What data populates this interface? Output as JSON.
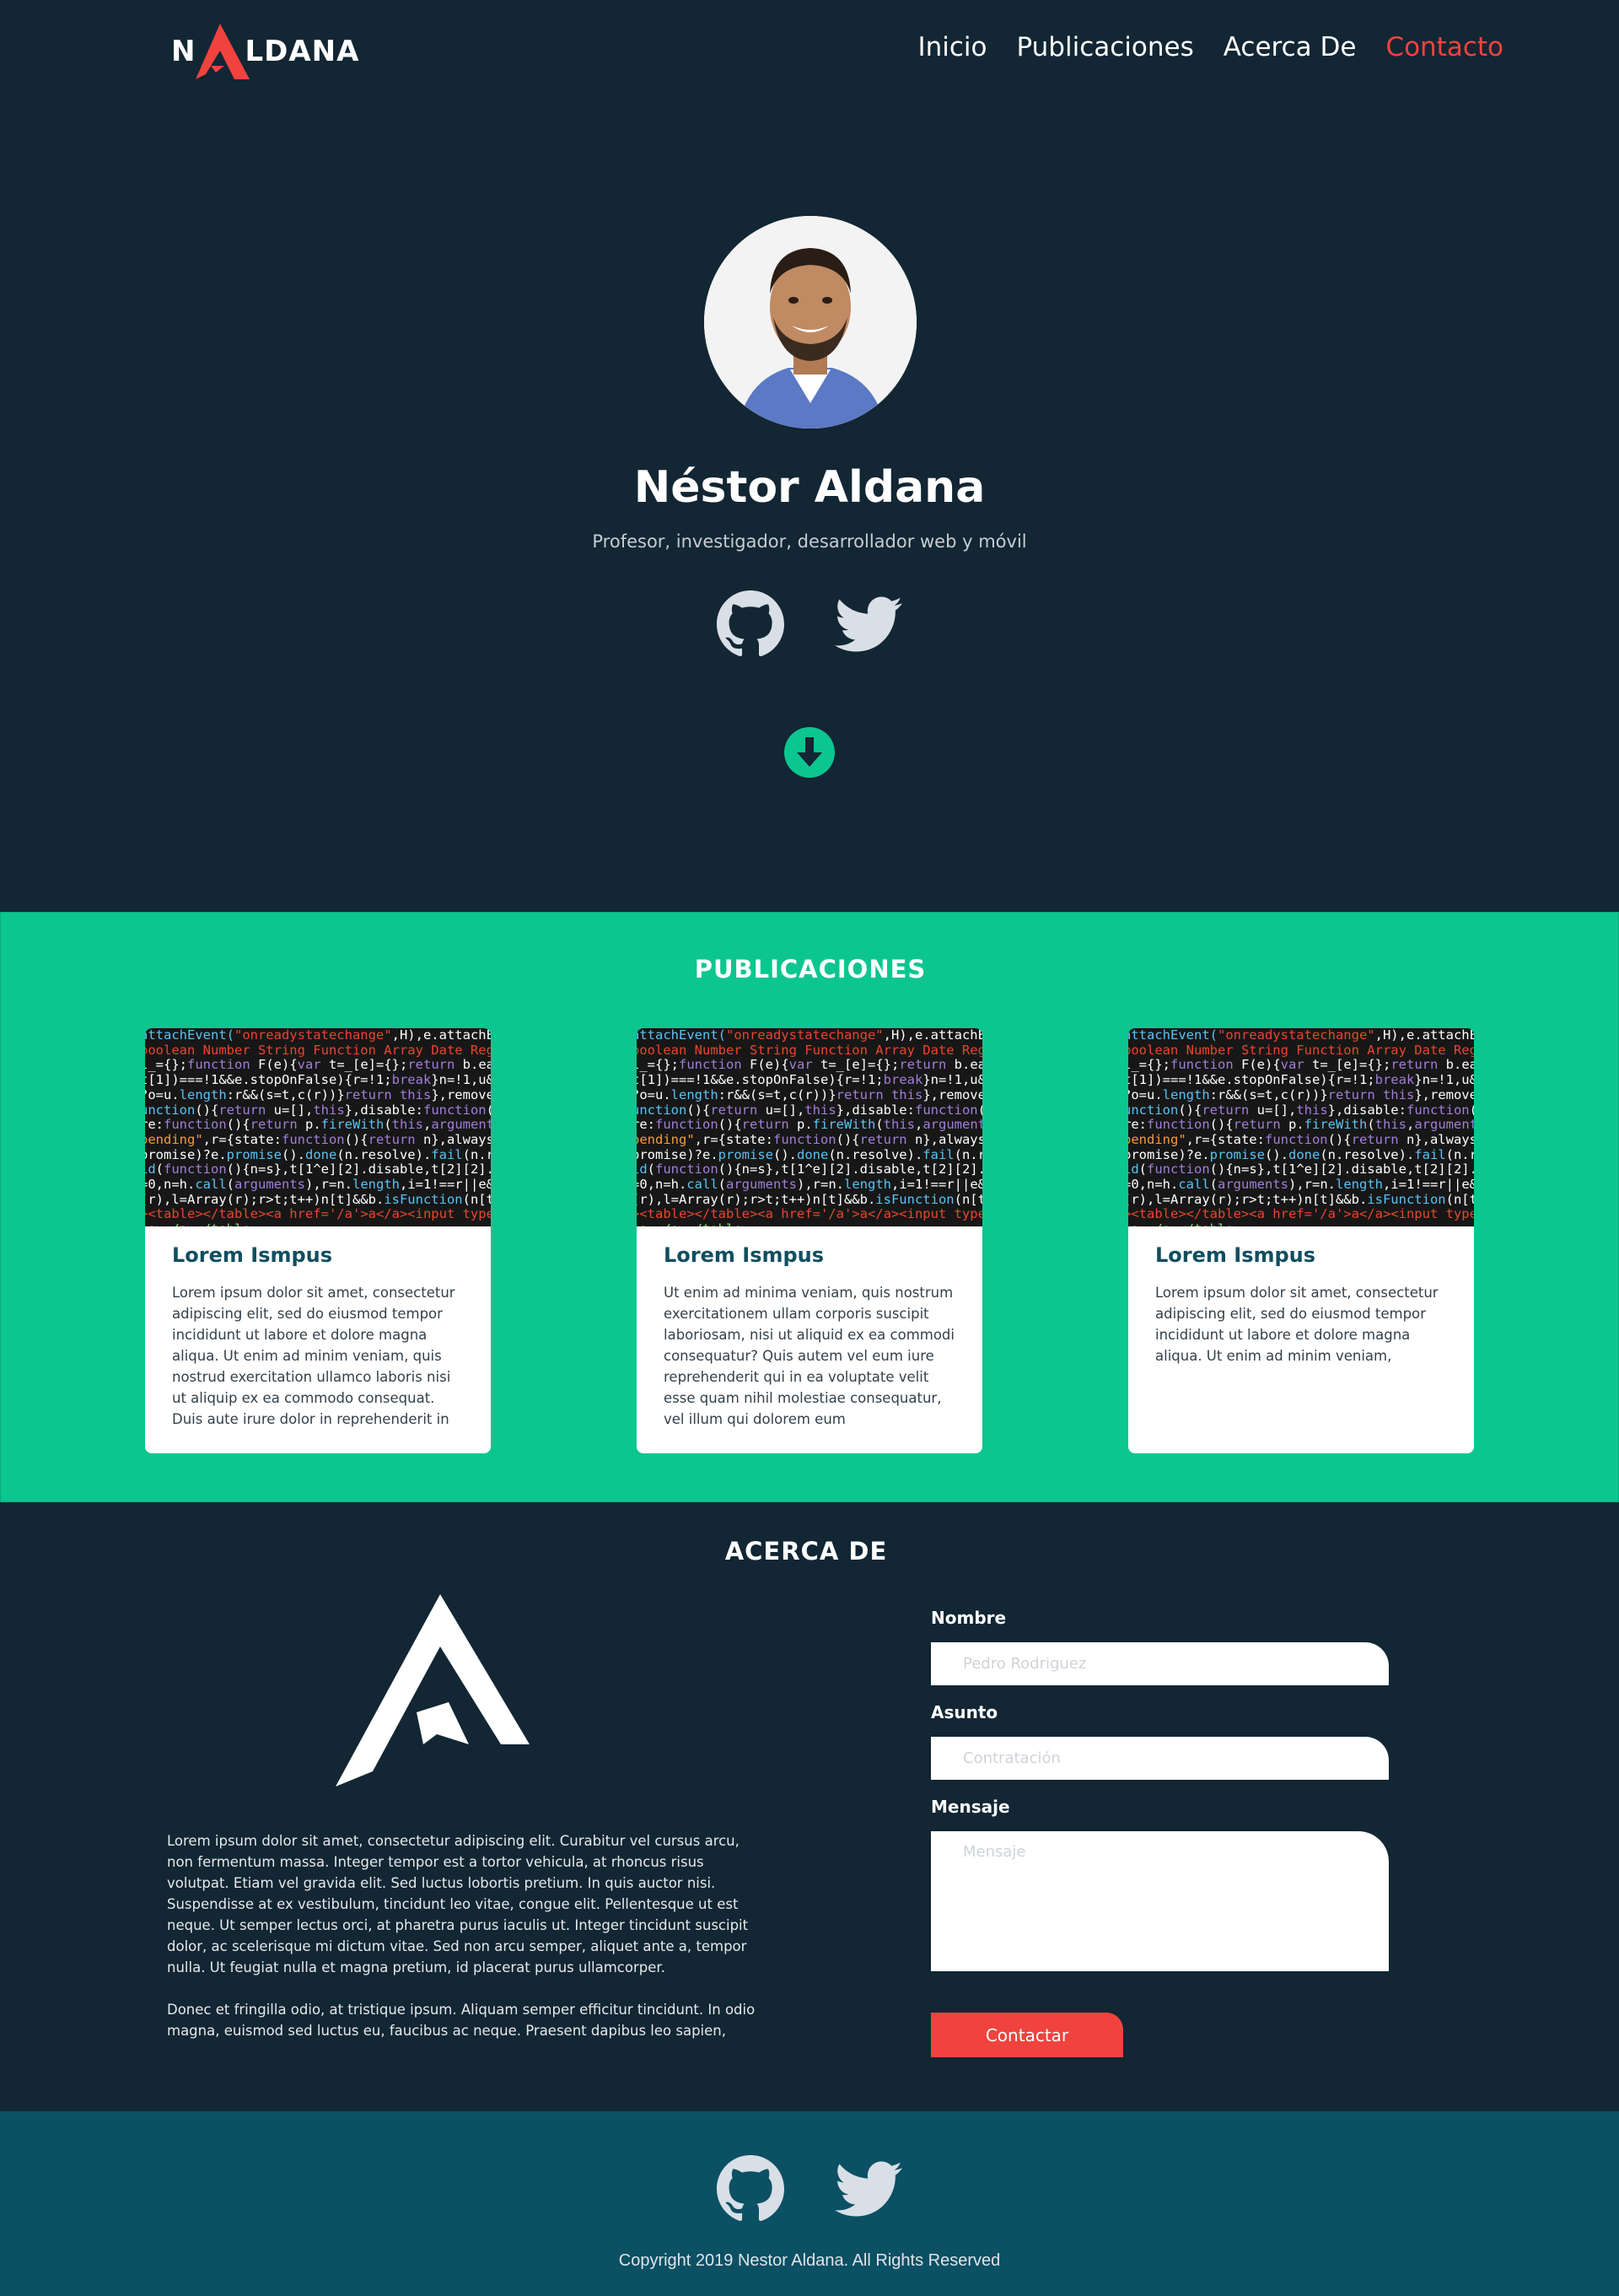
{
  "brand": {
    "logo_text_left": "N",
    "logo_text_right": "LDANA",
    "accent": "#f0433e"
  },
  "nav": {
    "items": [
      {
        "label": "Inicio"
      },
      {
        "label": "Publicaciones"
      },
      {
        "label": "Acerca De"
      },
      {
        "label": "Contacto",
        "active": true
      }
    ]
  },
  "hero": {
    "name": "Néstor Aldana",
    "subtitle": "Profesor, investigador, desarrollador web y móvil",
    "icons": [
      "github-icon",
      "twitter-icon",
      "arrow-down-circle-icon"
    ]
  },
  "publicaciones": {
    "title": "PUBLICACIONES",
    "background": "#0cc68f",
    "cards": [
      {
        "title": "Lorem Ismpus",
        "text": "Lorem ipsum dolor sit amet, consectetur adipiscing elit, sed do eiusmod tempor incididunt ut labore et dolore magna aliqua. Ut enim ad minim veniam, quis nostrud exercitation ullamco laboris nisi ut aliquip ex ea commodo consequat. Duis aute irure dolor in reprehenderit in"
      },
      {
        "title": "Lorem Ismpus",
        "text": "Ut enim ad minima veniam, quis nostrum exercitationem ullam corporis suscipit laboriosam, nisi ut aliquid ex ea commodi consequatur? Quis autem vel eum iure reprehenderit qui in ea voluptate velit esse quam nihil molestiae consequatur, vel illum qui dolorem eum"
      },
      {
        "title": "Lorem Ismpus",
        "text": "Lorem ipsum dolor sit amet, consectetur adipiscing elit, sed do eiusmod tempor incididunt ut labore et dolore magna aliqua. Ut enim ad minim veniam,"
      }
    ],
    "code_lines": [
      [
        [
          "c-a",
          "attachEvent("
        ],
        [
          "c-r",
          "\"onreadystatechange\""
        ],
        [
          "c-b",
          ",H),e.attachEvent"
        ]
      ],
      [
        [
          "c-r",
          "boolean Number String Function Array Date RegExp"
        ]
      ],
      [
        [
          "c-b",
          "l_={};"
        ],
        [
          "c-p",
          "function "
        ],
        [
          "c-b",
          "F(e){"
        ],
        [
          "c-p",
          "var "
        ],
        [
          "c-b",
          "t=_[e]={};"
        ],
        [
          "c-p",
          "return "
        ],
        [
          "c-b",
          "b.each"
        ]
      ],
      [
        [
          "c-b",
          "t[1])===!1&&e.stopOnFalse){r=!1;"
        ],
        [
          "c-p",
          "break"
        ],
        [
          "c-b",
          "}n=!1,u&&"
        ]
      ],
      [
        [
          "c-b",
          "?o=u."
        ],
        [
          "c-a",
          "length"
        ],
        [
          "c-b",
          ":r&&(s=t,c(r))}"
        ],
        [
          "c-p",
          "return this"
        ],
        [
          "c-b",
          "},remove"
        ]
      ],
      [
        [
          "c-a",
          "unction"
        ],
        [
          "c-b",
          "(){"
        ],
        [
          "c-p",
          "return "
        ],
        [
          "c-b",
          "u=[],"
        ],
        [
          "c-p",
          "this"
        ],
        [
          "c-b",
          "},disable:"
        ],
        [
          "c-p",
          "function"
        ],
        [
          "c-b",
          "()"
        ]
      ],
      [
        [
          "c-b",
          "re:"
        ],
        [
          "c-p",
          "function"
        ],
        [
          "c-b",
          "(){"
        ],
        [
          "c-p",
          "return "
        ],
        [
          "c-b",
          "p."
        ],
        [
          "c-a",
          "fireWith"
        ],
        [
          "c-b",
          "("
        ],
        [
          "c-p",
          "this"
        ],
        [
          "c-b",
          ","
        ],
        [
          "c-p",
          "arguments"
        ]
      ],
      [
        [
          "c-o",
          "pending\""
        ],
        [
          "c-b",
          ",r={state:"
        ],
        [
          "c-p",
          "function"
        ],
        [
          "c-b",
          "(){"
        ],
        [
          "c-p",
          "return "
        ],
        [
          "c-b",
          "n},always:"
        ]
      ],
      [
        [
          "c-b",
          "promise)?e."
        ],
        [
          "c-a",
          "promise"
        ],
        [
          "c-b",
          "()."
        ],
        [
          "c-a",
          "done"
        ],
        [
          "c-b",
          "(n.resolve)."
        ],
        [
          "c-a",
          "fail"
        ],
        [
          "c-b",
          "(n.rej"
        ]
      ],
      [
        [
          "c-a",
          "id"
        ],
        [
          "c-b",
          "("
        ],
        [
          "c-p",
          "function"
        ],
        [
          "c-b",
          "(){n=s},t[1^e][2].disable,t[2][2]."
        ]
      ],
      [
        [
          "c-b",
          "=0,n=h."
        ],
        [
          "c-a",
          "call"
        ],
        [
          "c-b",
          "("
        ],
        [
          "c-p",
          "arguments"
        ],
        [
          "c-b",
          "),r=n."
        ],
        [
          "c-a",
          "length"
        ],
        [
          "c-b",
          ",i=1!==r||e&&"
        ]
      ],
      [
        [
          "c-b",
          "(r),l=Array(r);r>t;t++)n[t]&&b."
        ],
        [
          "c-a",
          "isFunction"
        ],
        [
          "c-b",
          "(n[t]"
        ]
      ],
      [
        [
          "c-r",
          "><table></table><a href='/a'>a</a><input type"
        ]
      ],
      [
        [
          "c-b",
          "  "
        ],
        [
          "c-g",
          "<a></a></table>"
        ]
      ]
    ]
  },
  "acerca": {
    "title": "ACERCA DE",
    "paragraphs": [
      "Lorem ipsum dolor sit amet, consectetur adipiscing elit. Curabitur vel cursus arcu, non fermentum massa. Integer tempor est a tortor vehicula, at rhoncus risus volutpat. Etiam vel gravida elit. Sed luctus lobortis pretium. In quis auctor nisi. Suspendisse at ex vestibulum, tincidunt leo vitae, congue elit. Pellentesque ut est neque. Ut semper lectus orci, at pharetra purus iaculis ut. Integer tincidunt suscipit dolor, ac scelerisque mi dictum vitae. Sed non arcu semper, aliquet ante a, tempor nulla. Ut feugiat nulla et magna pretium, id placerat purus ullamcorper.",
      "Donec et fringilla odio, at tristique ipsum. Aliquam semper efficitur tincidunt. In odio magna, euismod sed luctus eu, faucibus ac neque. Praesent dapibus leo sapien,"
    ]
  },
  "form": {
    "nombre_label": "Nombre",
    "nombre_placeholder": "Pedro Rodriguez",
    "asunto_label": "Asunto",
    "asunto_placeholder": "Contratación",
    "mensaje_label": "Mensaje",
    "mensaje_placeholder": "Mensaje",
    "submit_label": "Contactar"
  },
  "footer": {
    "copyright": "Copyright 2019 Nestor Aldana. All Rights Reserved",
    "background": "#0c5064"
  }
}
